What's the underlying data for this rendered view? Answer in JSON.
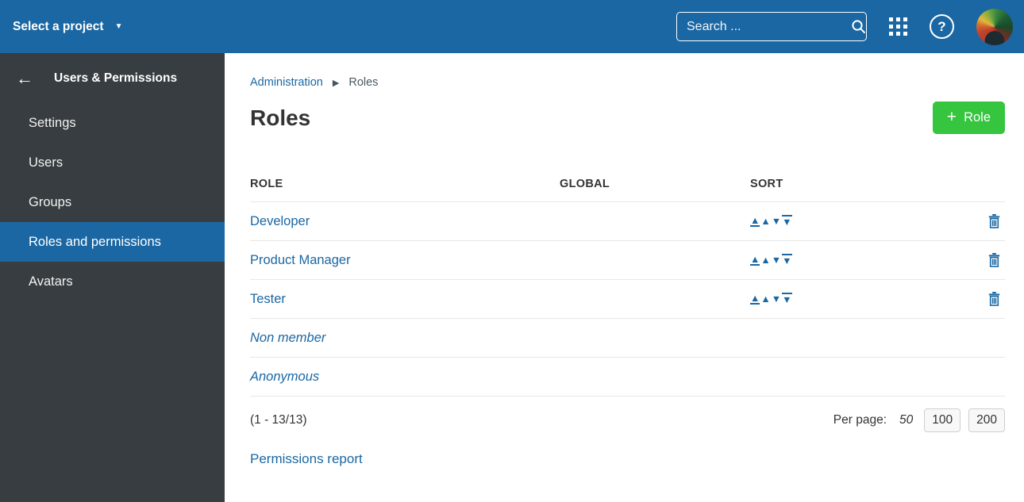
{
  "colors": {
    "accent_blue": "#1A67A3",
    "sidebar_bg": "#373D41",
    "button_green": "#35C53F",
    "divider": "#E7E7E7"
  },
  "topbar": {
    "project_selector": "Select a project",
    "search_placeholder": "Search ..."
  },
  "sidebar": {
    "title": "Users & Permissions",
    "items": [
      {
        "label": "Settings",
        "selected": false
      },
      {
        "label": "Users",
        "selected": false
      },
      {
        "label": "Groups",
        "selected": false
      },
      {
        "label": "Roles and permissions",
        "selected": true
      },
      {
        "label": "Avatars",
        "selected": false
      }
    ]
  },
  "breadcrumb": {
    "items": [
      "Administration",
      "Roles"
    ]
  },
  "page": {
    "title": "Roles",
    "add_button_label": "Role",
    "add_button_plus": "+"
  },
  "table": {
    "columns": [
      "ROLE",
      "GLOBAL",
      "SORT"
    ],
    "rows": [
      {
        "name": "Developer",
        "builtin": false,
        "sortable": true,
        "deletable": true
      },
      {
        "name": "Product Manager",
        "builtin": false,
        "sortable": true,
        "deletable": true
      },
      {
        "name": "Tester",
        "builtin": false,
        "sortable": true,
        "deletable": true
      },
      {
        "name": "Non member",
        "builtin": true,
        "sortable": false,
        "deletable": false
      },
      {
        "name": "Anonymous",
        "builtin": true,
        "sortable": false,
        "deletable": false
      }
    ]
  },
  "pagination": {
    "range": "(1 - 13/13)",
    "per_page_label": "Per page:",
    "current": "50",
    "options": [
      "100",
      "200"
    ]
  },
  "footer_link": "Permissions report"
}
